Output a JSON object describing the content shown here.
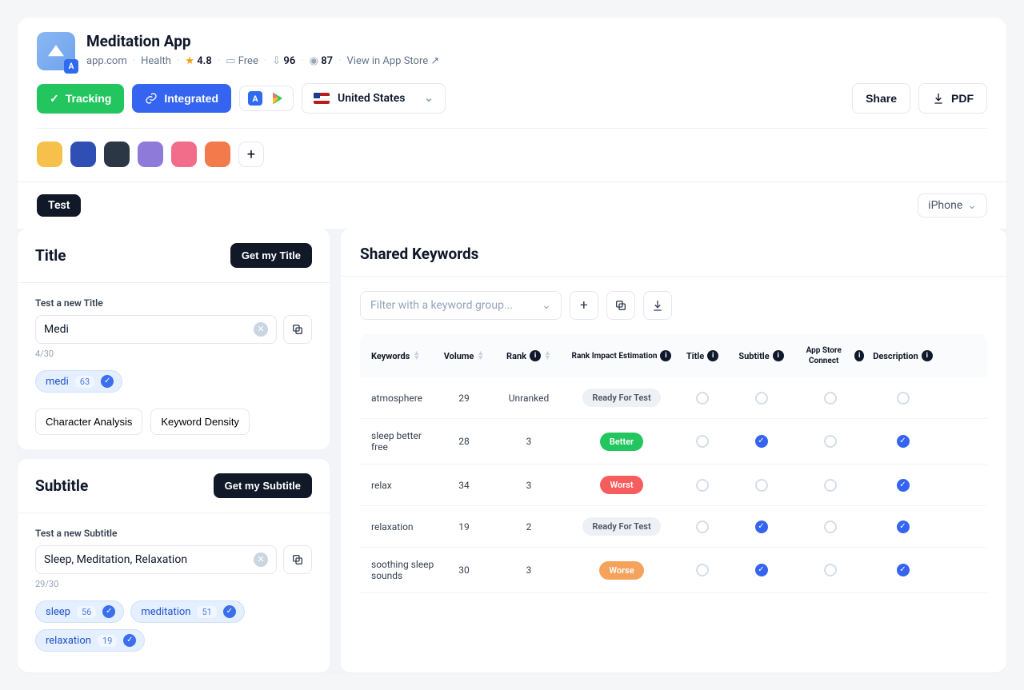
{
  "header": {
    "app_title": "Meditation App",
    "domain": "app.com",
    "category": "Health",
    "rating": "4.8",
    "price": "Free",
    "rank1": "96",
    "rank2": "87",
    "view_store": "View in App Store",
    "tracking_label": "Tracking",
    "integrated_label": "Integrated",
    "country": "United States",
    "share_label": "Share",
    "pdf_label": "PDF"
  },
  "swatch_colors": [
    "#f5c14a",
    "#2f4fb5",
    "#2c3746",
    "#8e7ad8",
    "#f26d8a",
    "#f37a4a"
  ],
  "toolbar": {
    "test_label": "Test",
    "device": "iPhone"
  },
  "title_panel": {
    "heading": "Title",
    "cta": "Get my Title",
    "field_label": "Test a new Title",
    "value": "Medi",
    "counter": "4/30",
    "tag": {
      "text": "medi",
      "count": "63"
    },
    "analysis": [
      "Character Analysis",
      "Keyword Density"
    ]
  },
  "subtitle_panel": {
    "heading": "Subtitle",
    "cta": "Get my Subtitle",
    "field_label": "Test a new Subtitle",
    "value": "Sleep, Meditation, Relaxation",
    "counter": "29/30",
    "tags": [
      {
        "text": "sleep",
        "count": "56"
      },
      {
        "text": "meditation",
        "count": "51"
      },
      {
        "text": "relaxation",
        "count": "19"
      }
    ]
  },
  "shared": {
    "heading": "Shared Keywords",
    "filter_placeholder": "Filter with a keyword group...",
    "columns": {
      "keywords": "Keywords",
      "volume": "Volume",
      "rank": "Rank",
      "impact": "Rank Impact Estimation",
      "title": "Title",
      "subtitle": "Subtitle",
      "asc": "App Store Connect",
      "desc": "Description"
    },
    "rows": [
      {
        "kw": "atmosphere",
        "vol": "29",
        "rank": "Unranked",
        "impact": "Ready For Test",
        "impact_class": "pill-gray",
        "title": false,
        "subtitle": false,
        "asc": false,
        "desc": false
      },
      {
        "kw": "sleep better free",
        "vol": "28",
        "rank": "3",
        "impact": "Better",
        "impact_class": "pill-green",
        "title": false,
        "subtitle": true,
        "asc": false,
        "desc": true
      },
      {
        "kw": "relax",
        "vol": "34",
        "rank": "3",
        "impact": "Worst",
        "impact_class": "pill-red",
        "title": false,
        "subtitle": false,
        "asc": false,
        "desc": true
      },
      {
        "kw": "relaxation",
        "vol": "19",
        "rank": "2",
        "impact": "Ready For Test",
        "impact_class": "pill-gray",
        "title": false,
        "subtitle": true,
        "asc": false,
        "desc": true
      },
      {
        "kw": "soothing sleep sounds",
        "vol": "30",
        "rank": "3",
        "impact": "Worse",
        "impact_class": "pill-orange",
        "title": false,
        "subtitle": true,
        "asc": false,
        "desc": true
      }
    ]
  }
}
